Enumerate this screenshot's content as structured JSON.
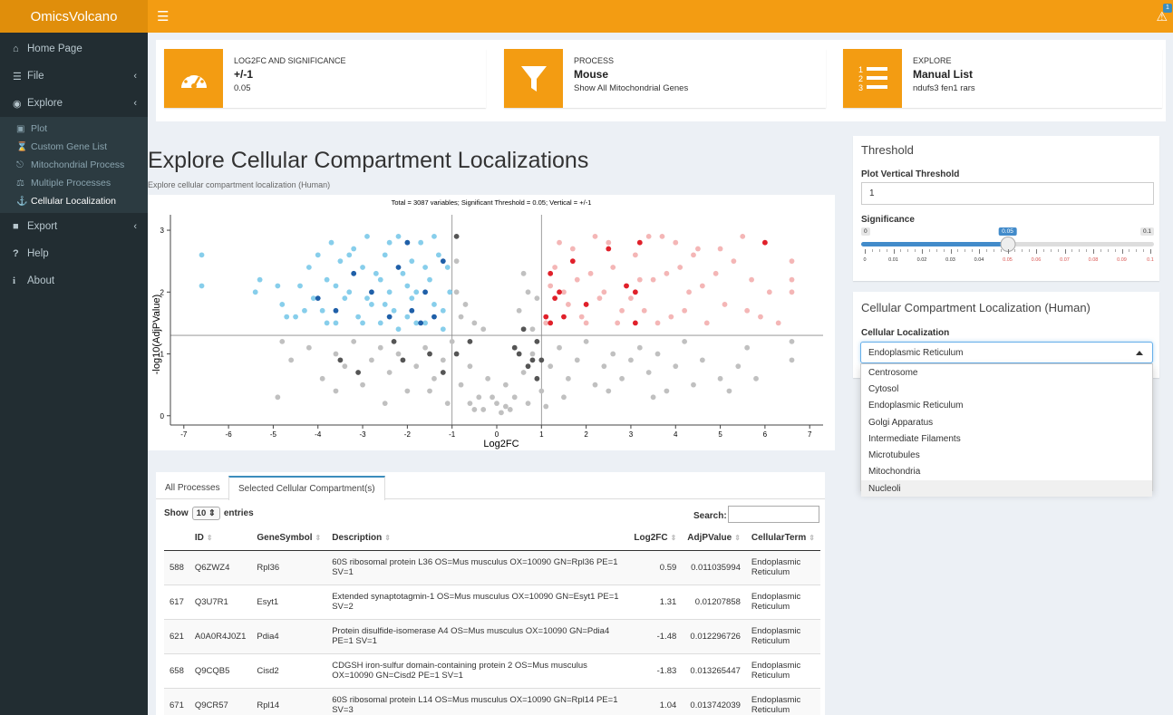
{
  "app": {
    "title": "OmicsVolcano"
  },
  "icons": {
    "menu": "hamburger-icon",
    "warning": "warning-icon",
    "badge": "1"
  },
  "sidebar": {
    "items": [
      {
        "label": "Home Page",
        "icon": "home-icon"
      },
      {
        "label": "File",
        "icon": "database-icon"
      },
      {
        "label": "Explore",
        "icon": "eye-icon"
      }
    ],
    "explore_sub": [
      {
        "label": "Plot",
        "icon": "image-icon"
      },
      {
        "label": "Custom Gene List",
        "icon": "hourglass-icon"
      },
      {
        "label": "Mitochondrial Process",
        "icon": "sitemap-icon"
      },
      {
        "label": "Multiple Processes",
        "icon": "balance-icon"
      },
      {
        "label": "Cellular Localization",
        "icon": "anchor-icon"
      }
    ],
    "bottom": [
      {
        "label": "Export",
        "icon": "save-icon"
      },
      {
        "label": "Help",
        "icon": "question-icon"
      },
      {
        "label": "About",
        "icon": "info-icon"
      }
    ]
  },
  "infoboxes": [
    {
      "label": "LOG2FC AND SIGNIFICANCE",
      "value": "+/-1",
      "sub": "0.05",
      "icon": "dashboard-icon"
    },
    {
      "label": "PROCESS",
      "value": "Mouse",
      "sub": "Show All Mitochondrial Genes",
      "icon": "filter-icon"
    },
    {
      "label": "EXPLORE",
      "value": "Manual List",
      "sub": "ndufs3 fen1 rars",
      "icon": "ordered-list-icon"
    }
  ],
  "main": {
    "title": "Explore Cellular Compartment Localizations",
    "subtitle": "Explore cellular compartment localization (Human)"
  },
  "chart_data": {
    "type": "scatter",
    "title": "Total = 3087 variables; Significant Threshold = 0.05; Vertical = +/-1",
    "xlabel": "Log2FC",
    "ylabel": "-log10(AdjPValue)",
    "xlim": [
      -7.3,
      7.3
    ],
    "ylim": [
      -0.15,
      3.25
    ],
    "xticks": [
      -7,
      -6,
      -5,
      -4,
      -3,
      -2,
      -1,
      0,
      1,
      2,
      3,
      4,
      5,
      6,
      7
    ],
    "yticks": [
      0,
      1,
      2,
      3
    ],
    "vlines": [
      -1,
      1
    ],
    "hline": 1.3,
    "colors": {
      "down": "#87ceeb",
      "down_highlight": "#1f5fa8",
      "up": "#f4b6b6",
      "up_highlight": "#e0202a",
      "ns": "#c0c0c0",
      "ns_highlight": "#555555"
    },
    "series": [
      {
        "group": "down",
        "points": [
          [
            -6.6,
            2.6
          ],
          [
            -6.6,
            2.1
          ],
          [
            -5.3,
            2.2
          ],
          [
            -5.4,
            2.0
          ],
          [
            -4.9,
            2.1
          ],
          [
            -4.8,
            1.8
          ],
          [
            -4.7,
            1.6
          ],
          [
            -4.5,
            1.6
          ],
          [
            -4.4,
            2.1
          ],
          [
            -4.2,
            2.4
          ],
          [
            -4.1,
            1.9
          ],
          [
            -4.0,
            2.6
          ],
          [
            -3.9,
            1.7
          ],
          [
            -3.8,
            2.2
          ],
          [
            -3.7,
            2.8
          ],
          [
            -3.6,
            1.5
          ],
          [
            -3.5,
            2.5
          ],
          [
            -3.4,
            1.9
          ],
          [
            -3.3,
            2.0
          ],
          [
            -3.2,
            2.7
          ],
          [
            -3.1,
            1.6
          ],
          [
            -3.0,
            2.4
          ],
          [
            -2.9,
            2.9
          ],
          [
            -2.8,
            1.8
          ],
          [
            -2.7,
            2.3
          ],
          [
            -2.6,
            1.5
          ],
          [
            -2.5,
            2.6
          ],
          [
            -2.4,
            2.0
          ],
          [
            -2.3,
            1.7
          ],
          [
            -2.2,
            2.9
          ],
          [
            -2.1,
            2.3
          ],
          [
            -2.0,
            1.6
          ],
          [
            -1.9,
            2.5
          ],
          [
            -1.8,
            2.0
          ],
          [
            -1.7,
            2.8
          ],
          [
            -1.6,
            1.5
          ],
          [
            -1.5,
            2.2
          ],
          [
            -1.4,
            1.8
          ],
          [
            -1.3,
            2.6
          ],
          [
            -1.2,
            1.4
          ],
          [
            -1.1,
            2.4
          ],
          [
            -1.05,
            2.0
          ],
          [
            -2.4,
            2.8
          ],
          [
            -3.6,
            2.1
          ],
          [
            -3.0,
            1.5
          ],
          [
            -2.0,
            2.1
          ],
          [
            -1.8,
            1.5
          ],
          [
            -1.4,
            2.9
          ],
          [
            -2.6,
            2.2
          ],
          [
            -3.3,
            2.6
          ],
          [
            -4.3,
            1.7
          ],
          [
            -2.9,
            1.9
          ],
          [
            -1.2,
            1.7
          ],
          [
            -2.2,
            1.4
          ],
          [
            -1.6,
            2.4
          ],
          [
            -3.8,
            1.5
          ],
          [
            -2.5,
            1.8
          ],
          [
            -1.9,
            1.9
          ]
        ]
      },
      {
        "group": "down_highlight",
        "points": [
          [
            -3.2,
            2.3
          ],
          [
            -2.8,
            2.0
          ],
          [
            -2.2,
            2.4
          ],
          [
            -1.9,
            1.7
          ],
          [
            -1.6,
            2.0
          ],
          [
            -1.4,
            1.6
          ],
          [
            -3.6,
            1.7
          ],
          [
            -2.4,
            1.6
          ],
          [
            -1.2,
            2.5
          ],
          [
            -2.0,
            2.8
          ],
          [
            -4.0,
            1.9
          ],
          [
            -1.7,
            1.5
          ]
        ]
      },
      {
        "group": "up",
        "points": [
          [
            1.1,
            1.5
          ],
          [
            1.3,
            2.4
          ],
          [
            1.5,
            2.0
          ],
          [
            1.7,
            2.7
          ],
          [
            1.9,
            1.6
          ],
          [
            2.1,
            2.3
          ],
          [
            2.3,
            1.9
          ],
          [
            2.5,
            2.8
          ],
          [
            2.7,
            1.5
          ],
          [
            2.9,
            2.1
          ],
          [
            3.1,
            2.6
          ],
          [
            3.3,
            1.7
          ],
          [
            3.5,
            2.2
          ],
          [
            3.7,
            2.9
          ],
          [
            3.9,
            1.6
          ],
          [
            4.1,
            2.4
          ],
          [
            4.3,
            2.0
          ],
          [
            4.5,
            2.7
          ],
          [
            4.7,
            1.5
          ],
          [
            4.9,
            2.3
          ],
          [
            5.1,
            1.8
          ],
          [
            5.3,
            2.5
          ],
          [
            5.5,
            2.9
          ],
          [
            5.7,
            2.2
          ],
          [
            5.9,
            1.6
          ],
          [
            6.1,
            2.0
          ],
          [
            6.3,
            1.5
          ],
          [
            6.6,
            2.5
          ],
          [
            6.6,
            2.2
          ],
          [
            6.6,
            2.0
          ],
          [
            1.4,
            2.8
          ],
          [
            1.8,
            2.2
          ],
          [
            2.2,
            2.9
          ],
          [
            2.6,
            2.4
          ],
          [
            3.0,
            1.9
          ],
          [
            3.4,
            2.9
          ],
          [
            3.8,
            2.3
          ],
          [
            4.2,
            1.7
          ],
          [
            4.6,
            2.1
          ],
          [
            5.0,
            2.7
          ],
          [
            5.6,
            1.7
          ],
          [
            2.0,
            1.5
          ],
          [
            1.6,
            1.8
          ],
          [
            2.8,
            1.7
          ],
          [
            3.6,
            1.5
          ],
          [
            4.4,
            2.6
          ],
          [
            1.2,
            2.1
          ],
          [
            2.4,
            2.0
          ],
          [
            3.2,
            2.2
          ],
          [
            4.0,
            2.8
          ]
        ]
      },
      {
        "group": "up_highlight",
        "points": [
          [
            1.2,
            2.3
          ],
          [
            1.3,
            1.9
          ],
          [
            1.5,
            1.6
          ],
          [
            1.7,
            2.5
          ],
          [
            2.0,
            1.8
          ],
          [
            2.5,
            2.7
          ],
          [
            3.1,
            2.0
          ],
          [
            3.2,
            2.8
          ],
          [
            6.0,
            2.8
          ],
          [
            1.1,
            1.6
          ],
          [
            2.9,
            2.1
          ],
          [
            3.1,
            1.5
          ],
          [
            1.4,
            2.0
          ],
          [
            1.2,
            1.5
          ]
        ]
      },
      {
        "group": "ns",
        "points": [
          [
            -4.8,
            1.2
          ],
          [
            -4.6,
            0.9
          ],
          [
            -4.2,
            1.1
          ],
          [
            -3.9,
            0.6
          ],
          [
            -3.6,
            1.0
          ],
          [
            -3.4,
            0.8
          ],
          [
            -3.2,
            1.2
          ],
          [
            -3.0,
            0.5
          ],
          [
            -2.8,
            0.9
          ],
          [
            -2.6,
            1.1
          ],
          [
            -2.4,
            0.7
          ],
          [
            -2.2,
            1.0
          ],
          [
            -2.0,
            0.4
          ],
          [
            -1.8,
            0.8
          ],
          [
            -1.6,
            1.1
          ],
          [
            -1.4,
            0.6
          ],
          [
            -1.2,
            0.9
          ],
          [
            -1.0,
            1.2
          ],
          [
            -0.8,
            0.5
          ],
          [
            -0.6,
            0.8
          ],
          [
            -0.4,
            0.3
          ],
          [
            -0.2,
            0.6
          ],
          [
            0.0,
            0.2
          ],
          [
            0.2,
            0.5
          ],
          [
            0.4,
            0.3
          ],
          [
            0.6,
            0.7
          ],
          [
            0.8,
            1.0
          ],
          [
            1.0,
            0.4
          ],
          [
            1.2,
            0.8
          ],
          [
            1.4,
            1.1
          ],
          [
            1.6,
            0.6
          ],
          [
            1.8,
            0.9
          ],
          [
            2.0,
            1.2
          ],
          [
            2.2,
            0.5
          ],
          [
            2.4,
            0.8
          ],
          [
            2.6,
            1.0
          ],
          [
            2.8,
            0.6
          ],
          [
            3.0,
            0.9
          ],
          [
            3.2,
            1.1
          ],
          [
            3.4,
            0.7
          ],
          [
            3.6,
            1.0
          ],
          [
            3.8,
            0.4
          ],
          [
            4.0,
            0.8
          ],
          [
            4.2,
            1.2
          ],
          [
            4.4,
            0.5
          ],
          [
            4.6,
            0.9
          ],
          [
            5.0,
            0.6
          ],
          [
            5.4,
            0.8
          ],
          [
            5.6,
            1.1
          ],
          [
            6.6,
            1.2
          ],
          [
            6.6,
            0.9
          ],
          [
            -4.9,
            0.3
          ],
          [
            -0.9,
            2.0
          ],
          [
            -0.7,
            1.8
          ],
          [
            -0.5,
            1.5
          ],
          [
            -0.3,
            1.4
          ],
          [
            -0.9,
            2.5
          ],
          [
            -0.8,
            1.6
          ],
          [
            0.5,
            1.7
          ],
          [
            0.7,
            2.0
          ],
          [
            0.9,
            1.9
          ],
          [
            0.6,
            2.3
          ],
          [
            0.8,
            1.4
          ],
          [
            -0.5,
            0.1
          ],
          [
            -0.3,
            0.1
          ],
          [
            0.1,
            0.05
          ],
          [
            0.3,
            0.1
          ],
          [
            -0.1,
            0.3
          ],
          [
            0.2,
            0.15
          ],
          [
            -0.6,
            0.2
          ],
          [
            0.7,
            0.2
          ],
          [
            -1.1,
            0.2
          ],
          [
            1.1,
            0.15
          ],
          [
            -1.5,
            0.4
          ],
          [
            1.5,
            0.3
          ],
          [
            -2.5,
            0.2
          ],
          [
            2.5,
            0.4
          ],
          [
            -3.6,
            0.4
          ],
          [
            3.5,
            0.3
          ],
          [
            5.2,
            0.4
          ],
          [
            5.8,
            0.6
          ]
        ]
      },
      {
        "group": "ns_highlight",
        "points": [
          [
            -2.3,
            1.2
          ],
          [
            -2.1,
            0.9
          ],
          [
            -1.5,
            1.0
          ],
          [
            -1.2,
            0.7
          ],
          [
            -3.5,
            0.9
          ],
          [
            -3.1,
            0.7
          ],
          [
            -0.9,
            1.0
          ],
          [
            -0.6,
            1.2
          ],
          [
            0.5,
            1.0
          ],
          [
            0.7,
            0.8
          ],
          [
            0.9,
            1.2
          ],
          [
            0.6,
            1.4
          ],
          [
            0.8,
            0.9
          ],
          [
            0.4,
            1.1
          ],
          [
            0.9,
            0.6
          ],
          [
            -0.9,
            2.9
          ],
          [
            1.0,
            0.9
          ]
        ]
      }
    ]
  },
  "threshold": {
    "title": "Threshold",
    "vertical_label": "Plot Vertical Threshold",
    "vertical_value": "1",
    "significance_label": "Significance",
    "min": "0",
    "max": "0.1",
    "value": "0.05",
    "value_num": 0.05,
    "ticks": [
      "0",
      "0.01",
      "0.02",
      "0.03",
      "0.04",
      "0.05",
      "0.06",
      "0.07",
      "0.08",
      "0.09",
      "0.1"
    ]
  },
  "localization": {
    "title": "Cellular Compartment Localization (Human)",
    "label": "Cellular Localization",
    "selected": "Endoplasmic Reticulum",
    "options": [
      "Centrosome",
      "Cytosol",
      "Endoplasmic Reticulum",
      "Golgi Apparatus",
      "Intermediate Filaments",
      "Microtubules",
      "Mitochondria",
      "Nucleoli"
    ]
  },
  "table": {
    "tabs": [
      "All Processes",
      "Selected Cellular Compartment(s)"
    ],
    "show_label": "Show",
    "entries_value": "10",
    "entries_label": "entries",
    "search_label": "Search:",
    "columns": [
      "",
      "ID",
      "GeneSymbol",
      "Description",
      "Log2FC",
      "AdjPValue",
      "CellularTerm"
    ],
    "rows": [
      [
        "588",
        "Q6ZWZ4",
        "Rpl36",
        "60S ribosomal protein L36 OS=Mus musculus OX=10090 GN=Rpl36 PE=1 SV=1",
        "0.59",
        "0.011035994",
        "Endoplasmic Reticulum"
      ],
      [
        "617",
        "Q3U7R1",
        "Esyt1",
        "Extended synaptotagmin-1 OS=Mus musculus OX=10090 GN=Esyt1 PE=1 SV=2",
        "1.31",
        "0.01207858",
        "Endoplasmic Reticulum"
      ],
      [
        "621",
        "A0A0R4J0Z1",
        "Pdia4",
        "Protein disulfide-isomerase A4 OS=Mus musculus OX=10090 GN=Pdia4 PE=1 SV=1",
        "-1.48",
        "0.012296726",
        "Endoplasmic Reticulum"
      ],
      [
        "658",
        "Q9CQB5",
        "Cisd2",
        "CDGSH iron-sulfur domain-containing protein 2 OS=Mus musculus OX=10090 GN=Cisd2 PE=1 SV=1",
        "-1.83",
        "0.013265447",
        "Endoplasmic Reticulum"
      ],
      [
        "671",
        "Q9CR57",
        "Rpl14",
        "60S ribosomal protein L14 OS=Mus musculus OX=10090 GN=Rpl14 PE=1 SV=3",
        "1.04",
        "0.013742039",
        "Endoplasmic Reticulum"
      ]
    ]
  }
}
